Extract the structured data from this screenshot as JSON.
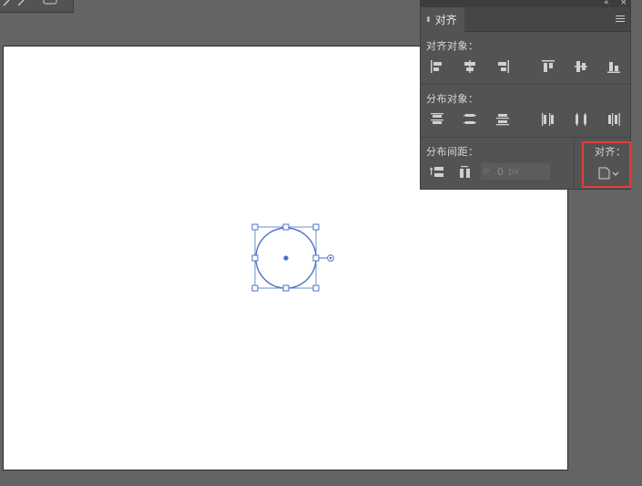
{
  "panel": {
    "tab_label": "对齐",
    "align_objects_label": "对齐对象：",
    "distribute_objects_label": "分布对象：",
    "distribute_spacing_label": "分布间距：",
    "align_to_label": "对齐：",
    "spacing_value": "0",
    "spacing_unit": "px"
  },
  "colors": {
    "selection": "#4a72c8",
    "highlight": "#e23b3b",
    "workspace": "#646464",
    "panel_bg": "#535353"
  }
}
